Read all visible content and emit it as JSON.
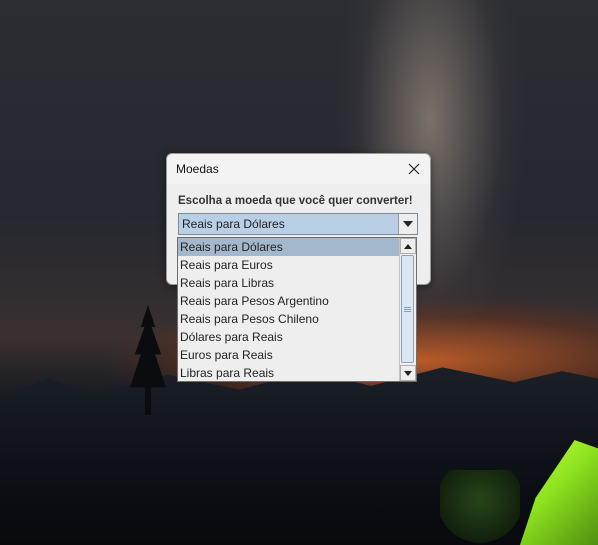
{
  "window": {
    "title": "Moedas",
    "close_icon": "close-icon"
  },
  "dialog": {
    "prompt": "Escolha a moeda que você quer converter!",
    "combo": {
      "selected": "Reais para Dólares"
    }
  },
  "dropdown": {
    "items": [
      {
        "label": "Reais para Dólares",
        "selected": true
      },
      {
        "label": "Reais para Euros",
        "selected": false
      },
      {
        "label": "Reais para Libras",
        "selected": false
      },
      {
        "label": "Reais para Pesos Argentino",
        "selected": false
      },
      {
        "label": "Reais para Pesos Chileno",
        "selected": false
      },
      {
        "label": "Dólares para Reais",
        "selected": false
      },
      {
        "label": "Euros para Reais",
        "selected": false
      },
      {
        "label": "Libras para Reais",
        "selected": false
      }
    ]
  },
  "colors": {
    "selection": "#a3b8cc",
    "combo_background": "#b8cfe5",
    "dialog_background": "#eeeeee"
  }
}
